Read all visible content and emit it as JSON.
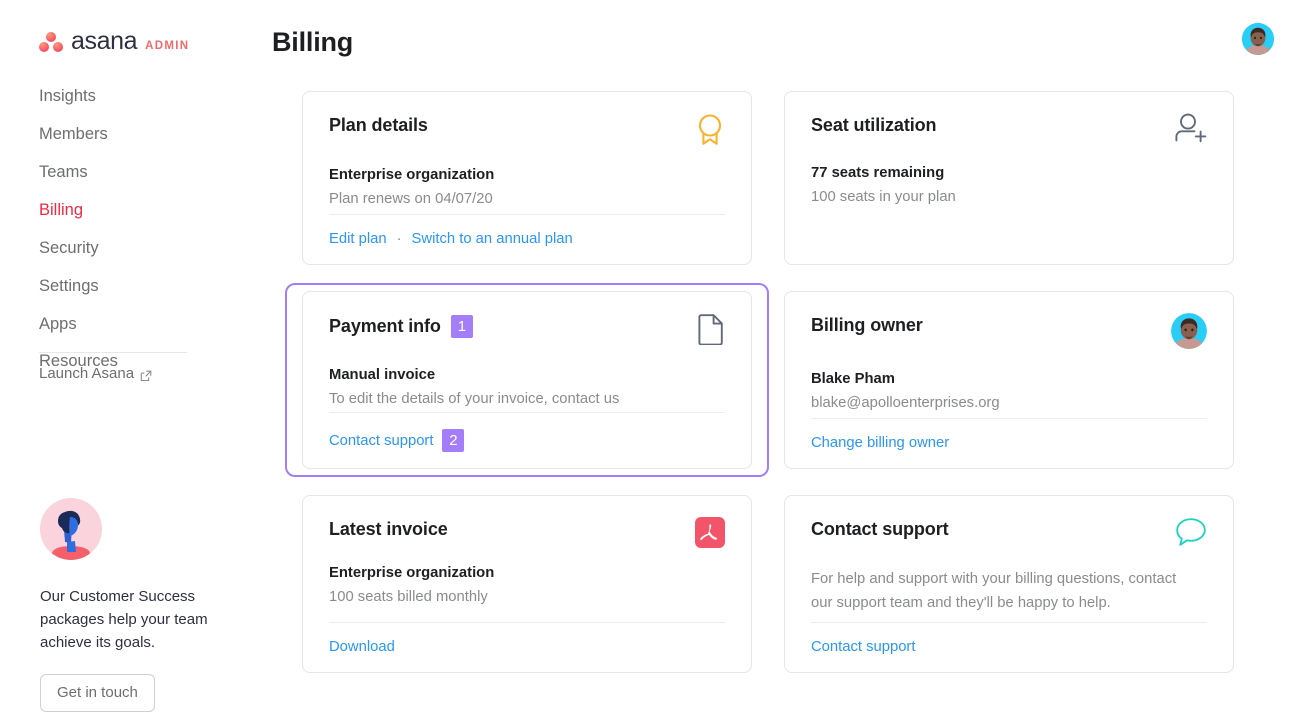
{
  "brand": {
    "word": "asana",
    "admin_label": "ADMIN",
    "logo_icon": "asana-dots-logo",
    "dot_color": "#f06a6a"
  },
  "sidebar": {
    "items": [
      {
        "label": "Insights",
        "active": false
      },
      {
        "label": "Members",
        "active": false
      },
      {
        "label": "Teams",
        "active": false
      },
      {
        "label": "Billing",
        "active": true
      },
      {
        "label": "Security",
        "active": false
      },
      {
        "label": "Settings",
        "active": false
      },
      {
        "label": "Apps",
        "active": false
      },
      {
        "label": "Resources",
        "active": false
      }
    ],
    "launch": {
      "label": "Launch Asana",
      "icon": "external-link-icon"
    },
    "promo": {
      "illustration_icon": "customer-success-avatar-illustration",
      "text": "Our Customer Success packages help your team achieve its goals.",
      "button_label": "Get in touch"
    }
  },
  "header": {
    "title": "Billing",
    "avatar_icon": "user-avatar"
  },
  "accents": {
    "active_nav": "#ec2b43",
    "link": "#2a96f5",
    "annotation_purple": "#a37ef8",
    "award_amber": "#fbb12f",
    "pdf_red": "#f2546a",
    "chat_teal": "#22d3c5",
    "avatar_cyan": "#29cdf5"
  },
  "cards": {
    "plan_details": {
      "title": "Plan details",
      "icon": "award-ribbon-icon",
      "primary": "Enterprise organization",
      "secondary": "Plan renews on 04/07/20",
      "link_primary": "Edit plan",
      "separator": "·",
      "link_secondary": "Switch to an annual plan"
    },
    "seat_utilization": {
      "title": "Seat utilization",
      "icon": "person-add-icon",
      "primary": "77 seats remaining",
      "secondary": "100 seats in your plan"
    },
    "payment_info": {
      "title": "Payment info",
      "icon": "document-icon",
      "badge_title": "1",
      "primary": "Manual invoice",
      "secondary": "To edit the details of your invoice, contact us",
      "link": "Contact support",
      "badge_link": "2",
      "highlighted": true
    },
    "billing_owner": {
      "title": "Billing owner",
      "icon": "user-avatar",
      "primary": "Blake Pham",
      "secondary": "blake@apolloenterprises.org",
      "link": "Change billing owner"
    },
    "latest_invoice": {
      "title": "Latest invoice",
      "icon": "pdf-file-icon",
      "primary": "Enterprise organization",
      "secondary": "100 seats billed monthly",
      "link": "Download"
    },
    "contact_support": {
      "title": "Contact support",
      "icon": "chat-bubble-icon",
      "description": "For help and support with your billing questions, contact our support team and they'll be happy to help.",
      "link": "Contact support"
    }
  }
}
